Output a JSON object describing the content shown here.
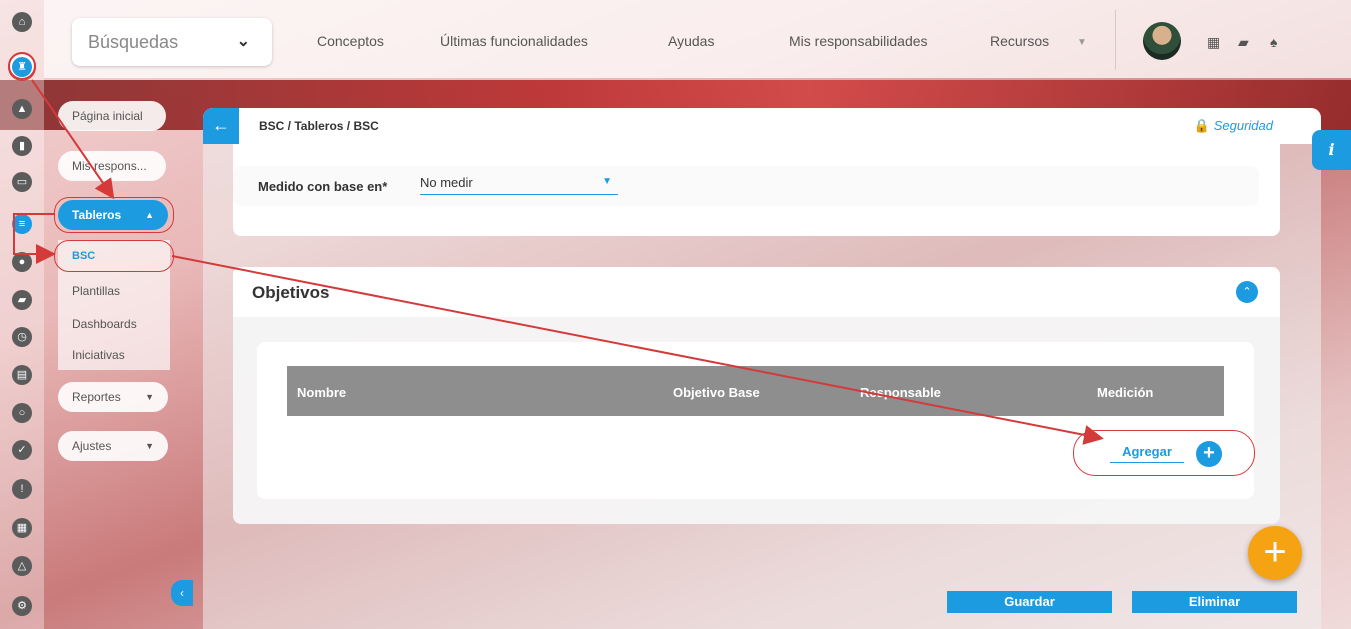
{
  "topbar": {
    "search_label": "Búsquedas",
    "menu": [
      "Conceptos",
      "Últimas funcionalidades",
      "Ayudas",
      "Mis responsabilidades",
      "Recursos"
    ]
  },
  "subnav": {
    "home": "Página inicial",
    "resp": "Mis respons...",
    "tableros": "Tableros",
    "items": [
      "BSC",
      "Plantillas",
      "Dashboards",
      "Iniciativas"
    ],
    "reportes": "Reportes",
    "ajustes": "Ajustes"
  },
  "main": {
    "breadcrumb": "BSC / Tableros / BSC",
    "security": "Seguridad",
    "info": "i",
    "medido_label": "Medido con base en*",
    "medido_value": "No medir",
    "objetivos_title": "Objetivos",
    "columns": [
      "Nombre",
      "Objetivo Base",
      "Responsable",
      "Medición"
    ],
    "add_label": "Agregar",
    "save": "Guardar",
    "delete": "Eliminar"
  },
  "colors": {
    "accent": "#1c9be0",
    "annotation": "#d43a3a",
    "fab": "#f5a313"
  },
  "icons": [
    "home-icon",
    "chess-icon",
    "triangle-icon",
    "chart-icon",
    "monitor-icon",
    "filter-icon",
    "folder-icon",
    "clock-icon",
    "document-icon",
    "cycle-icon",
    "check-icon",
    "alert-icon",
    "calendar-icon",
    "network-icon",
    "gear-icon",
    "lock-icon",
    "plus-icon",
    "back-arrow-icon"
  ]
}
